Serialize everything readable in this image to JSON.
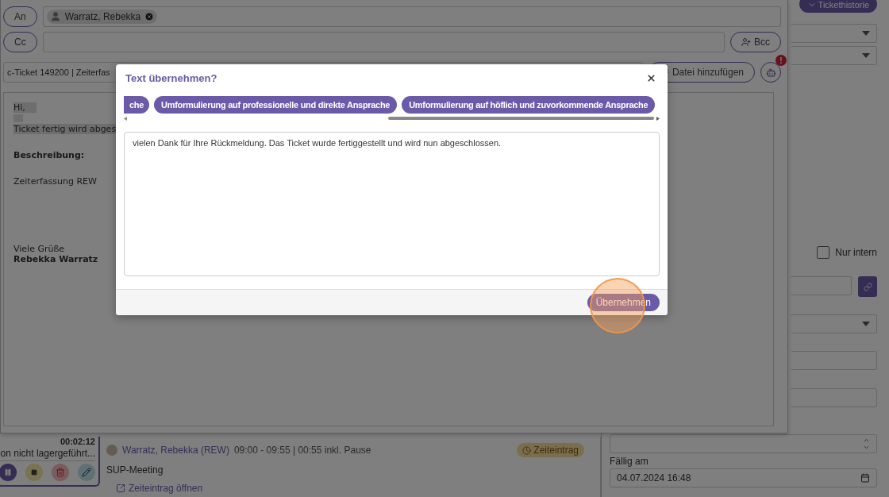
{
  "composer": {
    "to_label": "An",
    "recipients": [
      {
        "name": "Warratz, Rebekka"
      }
    ],
    "cc_label": "Cc",
    "bcc_button": "Bcc",
    "subject": "c-Ticket 149200 | Zeiterfas",
    "attach_button": "Datei hinzufügen",
    "assistant_badge": "!",
    "body": [
      {
        "lines": [
          {
            "kind": "highlight",
            "text": "Hi,"
          },
          {
            "kind": "highlight-blank"
          },
          {
            "kind": "highlight",
            "text": "Ticket fertig wird abges"
          }
        ]
      },
      {
        "lines": [
          {
            "kind": "bold",
            "text": "Beschreibung:"
          }
        ]
      },
      {
        "lines": [
          {
            "kind": "plain",
            "text": "Zeiterfassung REW"
          }
        ]
      },
      {
        "lines": [
          {
            "kind": "plain",
            "text": "Viele Grüße"
          },
          {
            "kind": "bold",
            "text": "Rebekka Warratz"
          }
        ]
      }
    ]
  },
  "timer": {
    "time": "00:02:12",
    "title": "on nicht lagergeführt..."
  },
  "entry": {
    "author": "Warratz, Rebekka (REW)",
    "time": "09:00 - 09:55 | 00:55 inkl. Pause",
    "badge": "Zeiteintrag",
    "text": "SUP-Meeting",
    "link": "Zeiteintrag öffnen"
  },
  "sidebar": {
    "history_button": "Tickethistorie",
    "internal_checkbox": {
      "label": "Nur intern",
      "checked": false
    },
    "due_label": "Fällig am",
    "due_value": "04.07.2024 16:48"
  },
  "modal": {
    "title": "Text übernehmen?",
    "chips": [
      {
        "label": "che",
        "partial": true
      },
      {
        "label": "Umformulierung auf professionelle und direkte Ansprache",
        "partial": false
      },
      {
        "label": "Umformulierung auf höflich und zuvorkommende Ansprache",
        "partial": false
      }
    ],
    "text": "vielen Dank für Ihre Rückmeldung. Das Ticket wurde fertiggestellt und wird nun abgeschlossen.",
    "apply_button": "Übernehmen"
  }
}
